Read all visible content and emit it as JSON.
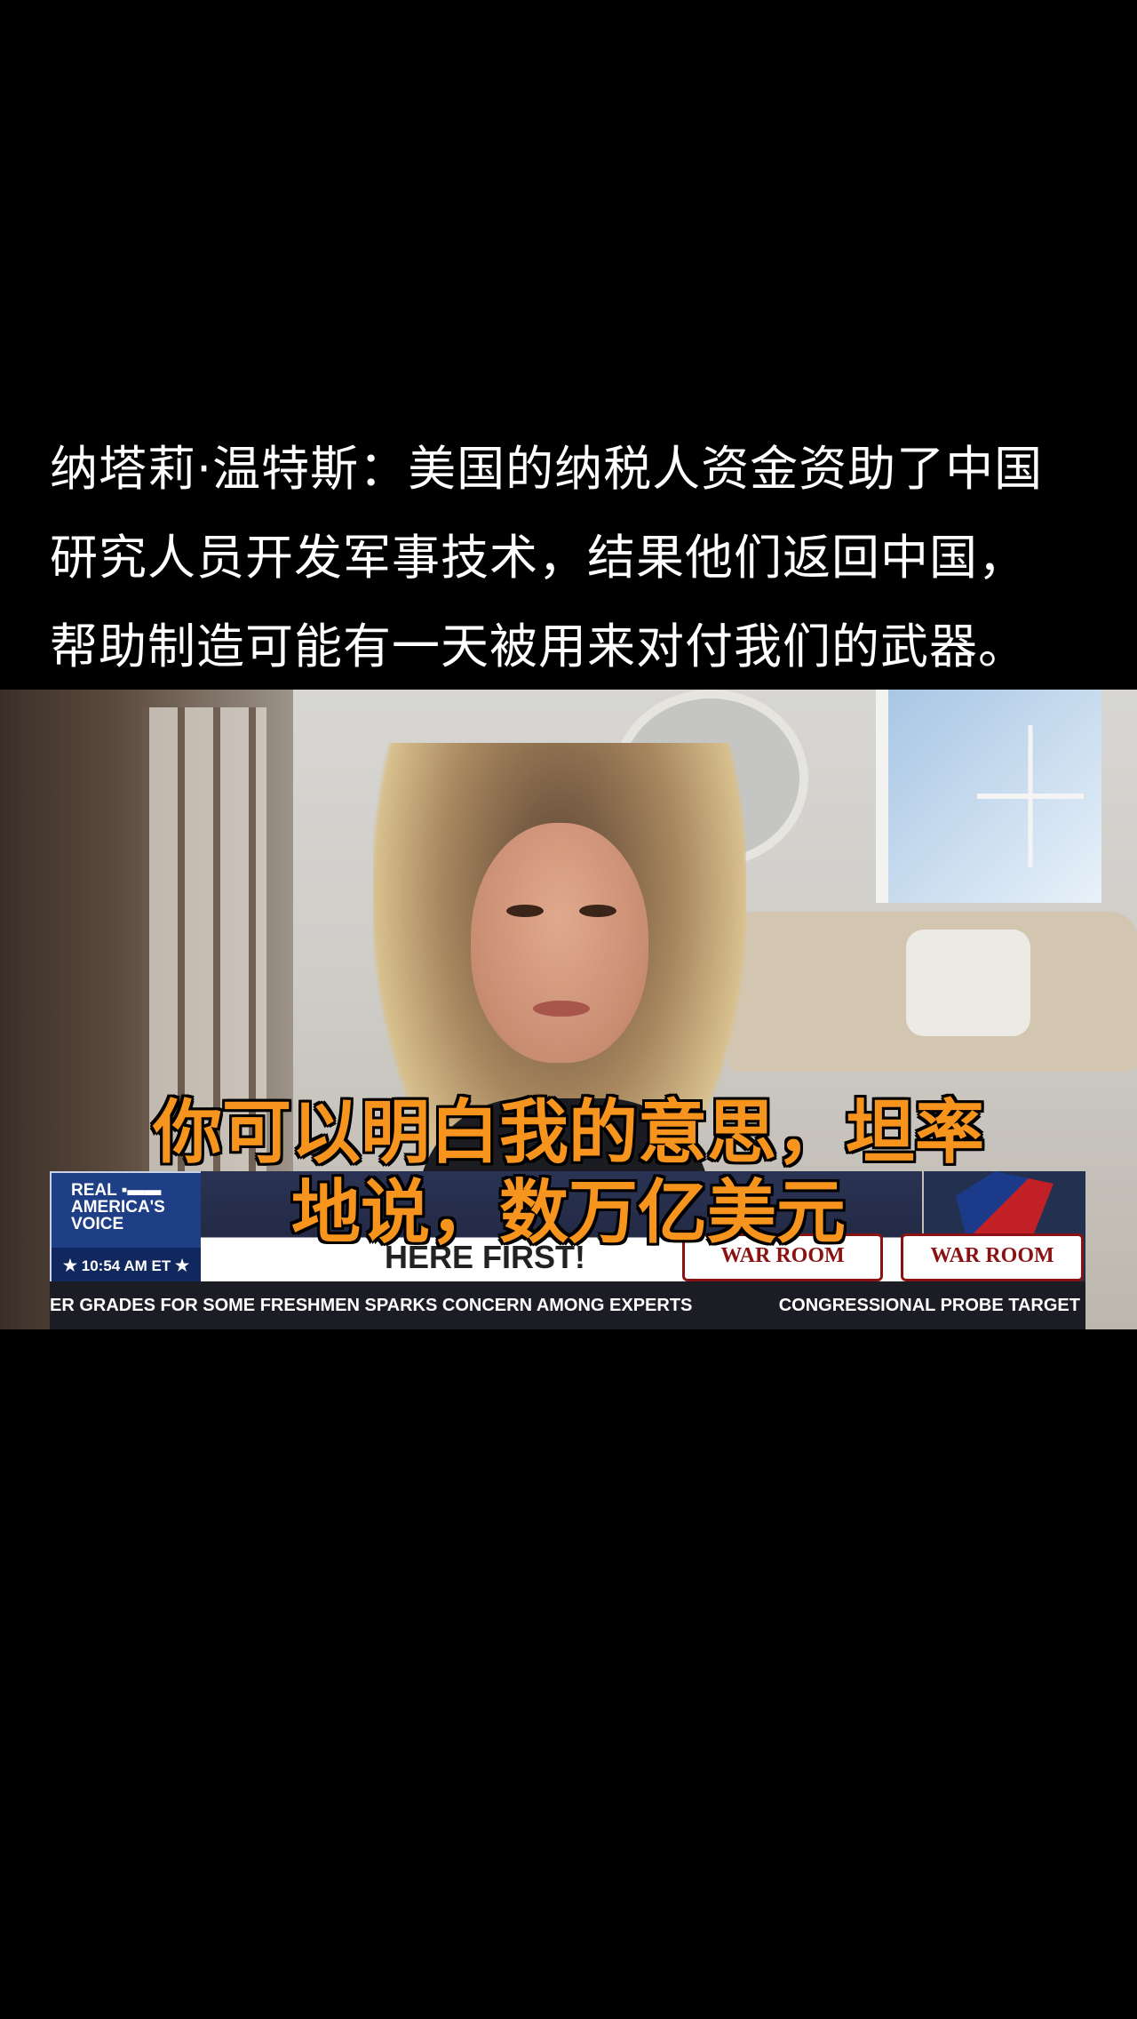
{
  "caption": {
    "lines": [
      "纳塔莉·温特斯：美国的纳税人资金资助了中国",
      "研究人员开发军事技术，结果他们返回中国，",
      "帮助制造可能有一天被用来对付我们的武器。"
    ]
  },
  "subtitles": {
    "line1": "你可以明白我的意思，坦率",
    "line2": "地说，数万亿美元"
  },
  "lower_third": {
    "brand_lines": [
      "REAL ▪▬▬",
      "AMERICA'S",
      "VOICE"
    ],
    "time": "10:54 AM ET",
    "headline": "HERE FIRST!",
    "badge_a": "WAR ROOM",
    "badge_b": "WAR ROOM",
    "ticker_left": "ER GRADES FOR SOME FRESHMEN SPARKS CONCERN AMONG EXPERTS",
    "ticker_right": "CONGRESSIONAL PROBE TARGET"
  },
  "colors": {
    "subtitle": "#f7941d",
    "brand": "#1e3f86",
    "badge": "#8b1212"
  }
}
